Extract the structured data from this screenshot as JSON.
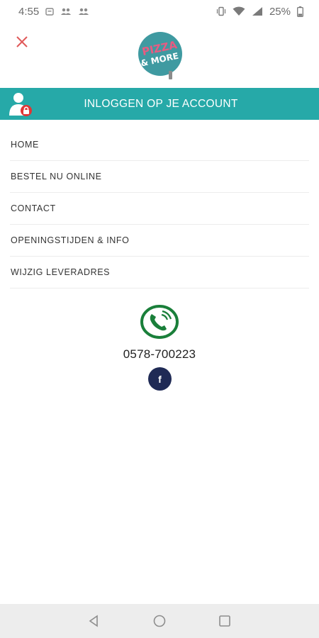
{
  "status_bar": {
    "time": "4:55",
    "battery": "25%"
  },
  "header": {
    "logo_line1": "PIZZA",
    "logo_line2": "& MORE"
  },
  "login": {
    "label": "INLOGGEN OP JE ACCOUNT"
  },
  "menu": {
    "items": [
      {
        "label": "HOME"
      },
      {
        "label": "BESTEL NU ONLINE"
      },
      {
        "label": "CONTACT"
      },
      {
        "label": "OPENINGSTIJDEN & INFO"
      },
      {
        "label": "WIJZIG LEVERADRES"
      }
    ]
  },
  "contact": {
    "phone": "0578-700223",
    "facebook_glyph": "f"
  },
  "colors": {
    "accent": "#26a9a8",
    "close": "#e05a5a",
    "phone_green": "#1a7f3a",
    "facebook": "#1f2a55",
    "lock_red": "#e03535"
  }
}
